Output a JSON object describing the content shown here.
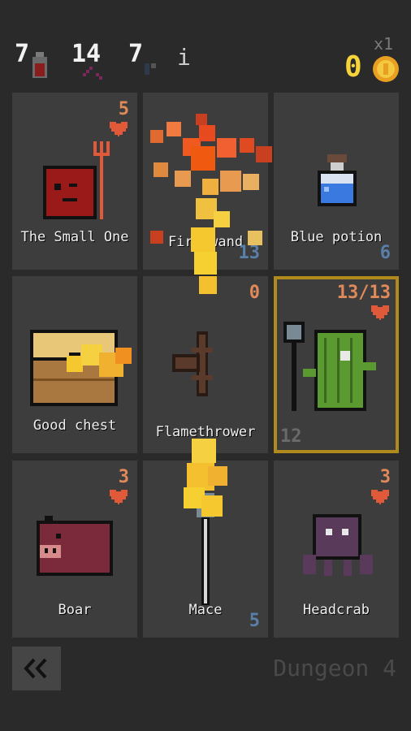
{
  "hud": {
    "stat1": "7",
    "stat2": "14",
    "stat3": "7",
    "info": "i",
    "gold": "0",
    "gold_multiplier": "x1"
  },
  "cards": [
    {
      "name": "The Small One",
      "top": "5",
      "bottom": ""
    },
    {
      "name": "Fire wand",
      "top": "",
      "bottom": "13"
    },
    {
      "name": "Blue potion",
      "top": "",
      "bottom": "6"
    },
    {
      "name": "Good chest",
      "top": "",
      "bottom": ""
    },
    {
      "name": "Flamethrower",
      "top": "0",
      "bottom": ""
    },
    {
      "name": "",
      "top": "13/13",
      "bottom": "12"
    },
    {
      "name": "Boar",
      "top": "3",
      "bottom": ""
    },
    {
      "name": "Mace",
      "top": "",
      "bottom": "5"
    },
    {
      "name": "Headcrab",
      "top": "3",
      "bottom": ""
    }
  ],
  "footer": {
    "dungeon": "Dungeon 4",
    "back_icon": "double-chevron-left"
  },
  "colors": {
    "heart": "#e05a3a",
    "top_number": "#e08a5a",
    "bottom_number": "#5a7fa8",
    "gold": "#f5d33a",
    "selected_border": "#b08a1c"
  }
}
